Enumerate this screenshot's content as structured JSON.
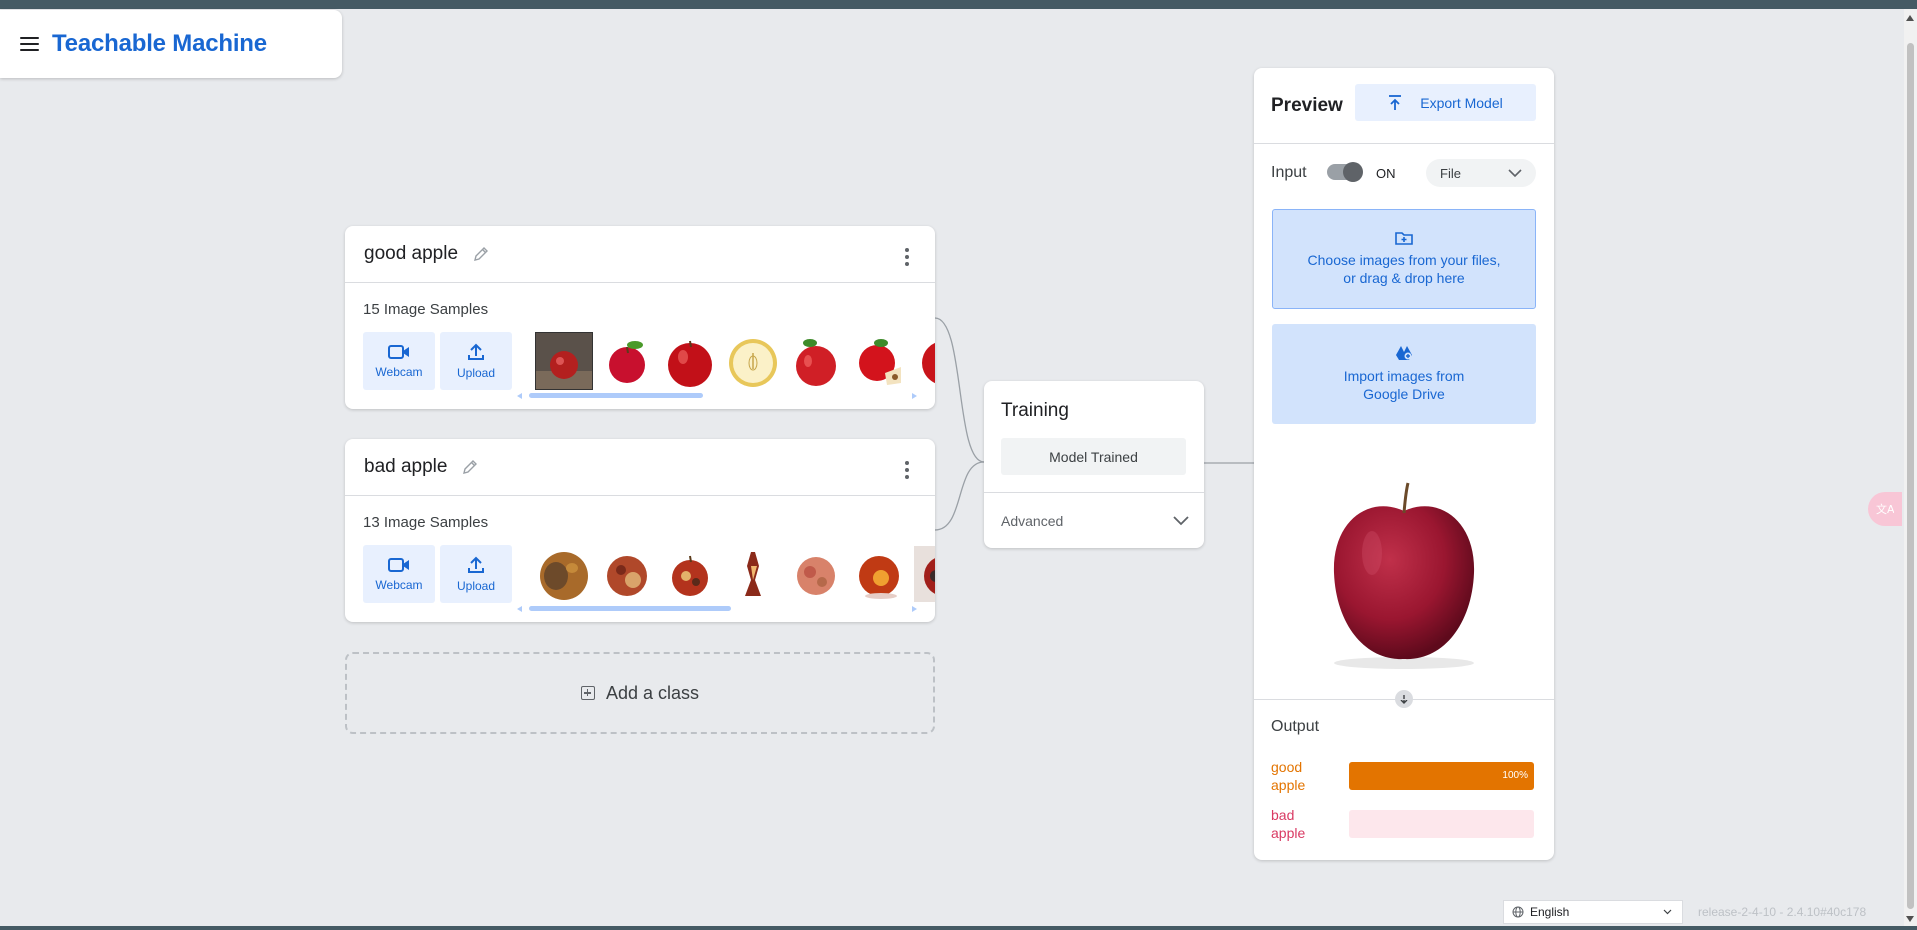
{
  "app": {
    "title": "Teachable Machine"
  },
  "classes": [
    {
      "name": "good apple",
      "samples_label": "15 Image Samples",
      "webcam_label": "Webcam",
      "upload_label": "Upload"
    },
    {
      "name": "bad apple",
      "samples_label": "13 Image Samples",
      "webcam_label": "Webcam",
      "upload_label": "Upload"
    }
  ],
  "add_class": {
    "label": "Add a class"
  },
  "training": {
    "title": "Training",
    "status_button": "Model Trained",
    "advanced_label": "Advanced"
  },
  "preview": {
    "title": "Preview",
    "export_label": "Export Model",
    "input_label": "Input",
    "toggle_state": "ON",
    "input_source": "File",
    "drop_zone_text_1": "Choose images from your files,",
    "drop_zone_text_2": "or drag & drop here",
    "drive_text_1": "Import images from",
    "drive_text_2": "Google Drive",
    "output_label": "Output",
    "outputs": [
      {
        "name_1": "good",
        "name_2": "apple",
        "value": 1.0,
        "percent_label": "100%",
        "color": "#e37400",
        "bg": "#fce8d0"
      },
      {
        "name_1": "bad",
        "name_2": "apple",
        "value": 0.0,
        "percent_label": "",
        "color": "#d93a63",
        "bg": "#fde7ec"
      }
    ]
  },
  "footer": {
    "language": "English",
    "version": "release-2-4-10 - 2.4.10#40c178"
  },
  "colors": {
    "accent": "#1967d2",
    "accent_bg": "#e8f0fe",
    "topbar": "#455a64",
    "background": "#e8eaed"
  },
  "icons": [
    "menu-icon",
    "pencil-icon",
    "kebab-icon",
    "webcam-icon",
    "upload-icon",
    "plus-icon",
    "chevron-down-icon",
    "export-icon",
    "folder-add-icon",
    "google-drive-icon",
    "arrow-down-icon",
    "translate-icon",
    "globe-icon"
  ]
}
